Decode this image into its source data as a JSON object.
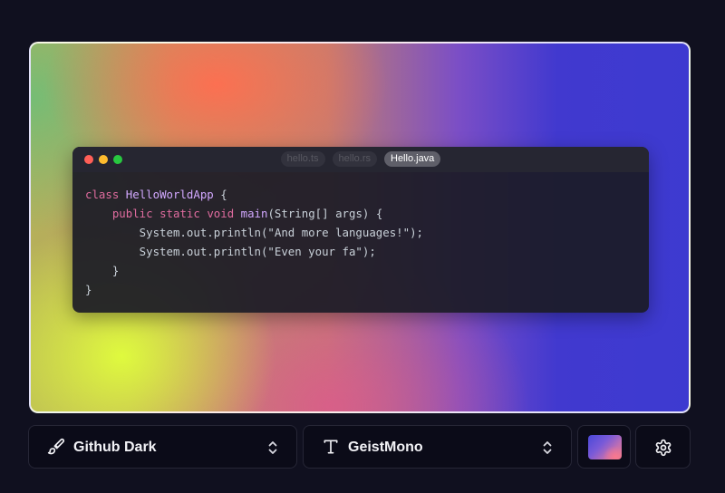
{
  "preview": {
    "tabs": [
      {
        "label": "hello.ts",
        "active": false
      },
      {
        "label": "hello.rs",
        "active": false
      },
      {
        "label": "Hello.java",
        "active": true
      }
    ],
    "code_lines": [
      "class HelloWorldApp {",
      "    public static void main(String[] args) {",
      "        System.out.println(\"And more languages!\");",
      "        System.out.println(\"Even your fa\");",
      "    }",
      "}"
    ]
  },
  "toolbar": {
    "theme_label": "Github Dark",
    "font_label": "GeistMono",
    "theme_icon": "paintbrush-icon",
    "font_icon": "text-type-icon",
    "settings_icon": "gear-icon"
  },
  "colors": {
    "page_background": "#10101f",
    "code_background": "#1b1b26",
    "keyword": "#e06c9f",
    "type": "#d2a8ff"
  }
}
